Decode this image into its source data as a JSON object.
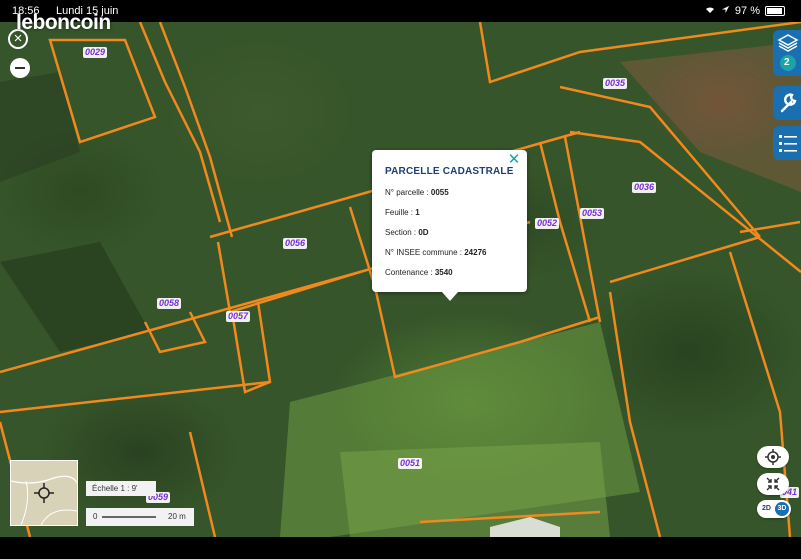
{
  "status_bar": {
    "time": "18:56",
    "date": "Lundi 15 juin",
    "battery": "97 %"
  },
  "watermark": "leboncoin",
  "map": {
    "parcel_labels": [
      "0029",
      "0035",
      "0036",
      "0052",
      "0053",
      "0056",
      "0058",
      "0057",
      "0051",
      "0059",
      "041"
    ],
    "parcel_color": "#f0891e",
    "label_color": "#7b2fd6"
  },
  "popup": {
    "title": "PARCELLE CADASTRALE",
    "rows": [
      {
        "label": "N° parcelle : ",
        "value": "0055"
      },
      {
        "label": "Feuille : ",
        "value": "1"
      },
      {
        "label": "Section : ",
        "value": "0D"
      },
      {
        "label": "N° INSEE commune : ",
        "value": "24276"
      },
      {
        "label": "Contenance : ",
        "value": "3540"
      }
    ]
  },
  "controls": {
    "layers_badge": "2",
    "scale_label": "Échelle 1 :",
    "scale_value": "9'",
    "scale_start": "0",
    "scale_end": "20 m",
    "mode_2d": "2D",
    "mode_3d": "3D"
  },
  "colors": {
    "accent": "#1a6fb0",
    "popup_title": "#1d3f73",
    "close": "#1aa3a8"
  }
}
